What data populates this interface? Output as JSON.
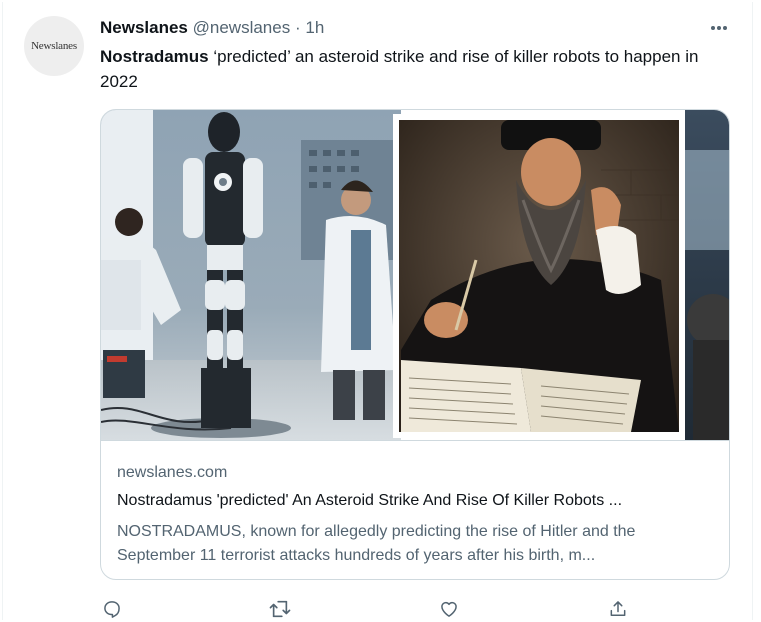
{
  "tweet": {
    "avatar_text": "Newslanes",
    "display_name": "Newslanes",
    "handle": "@newslanes",
    "separator": "·",
    "time": "1h",
    "text_bold": "Nostradamus",
    "text_rest": " ‘predicted’ an asteroid strike and rise of killer robots to happen in 2022"
  },
  "card": {
    "image_description": "Composite image: scientists in a lab with a humanoid robot exoskeleton on the left, a portrait of Nostradamus writing in a book with a quill on the right",
    "domain": "newslanes.com",
    "title": "Nostradamus 'predicted' An Asteroid Strike And Rise Of Killer Robots ...",
    "description": "NOSTRADAMUS, known for allegedly predicting the rise of Hitler and the September 11 terrorist attacks hundreds of years after his birth, m..."
  },
  "actions": {
    "reply_icon": "reply-icon",
    "retweet_icon": "retweet-icon",
    "like_icon": "heart-icon",
    "share_icon": "share-icon",
    "more_icon": "more-dots-icon"
  },
  "colors": {
    "text_primary": "#0f1419",
    "text_secondary": "#536471",
    "border": "#cfd9de"
  }
}
